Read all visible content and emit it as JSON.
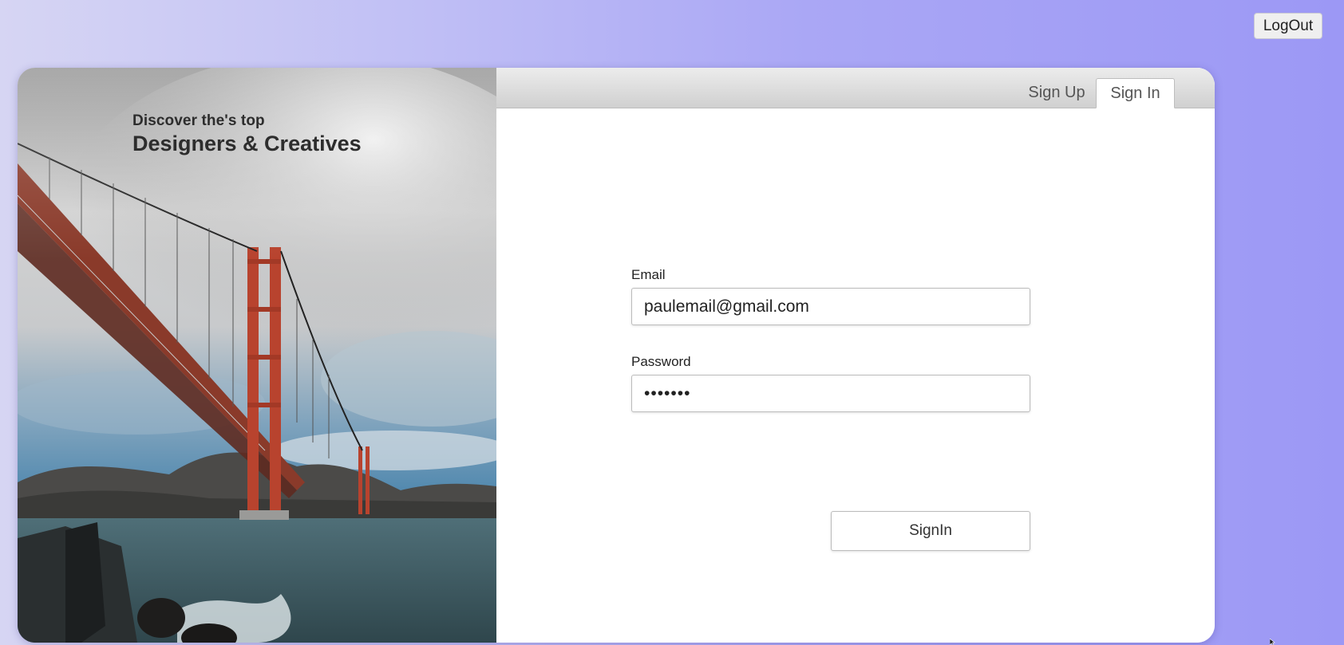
{
  "header": {
    "logout_label": "LogOut"
  },
  "hero": {
    "tagline_small": "Discover the's top",
    "tagline_large": "Designers & Creatives"
  },
  "tabs": [
    {
      "label": "Sign Up",
      "active": false
    },
    {
      "label": "Sign In",
      "active": true
    }
  ],
  "form": {
    "email_label": "Email",
    "email_value": "paulemail@gmail.com",
    "password_label": "Password",
    "password_value": "•••••••",
    "submit_label": "SignIn"
  },
  "colors": {
    "background_left": "#d6d5f3",
    "background_right": "#9c98f5",
    "bridge_red": "#b8432e"
  },
  "icons": [
    "mouse-cursor-icon"
  ]
}
